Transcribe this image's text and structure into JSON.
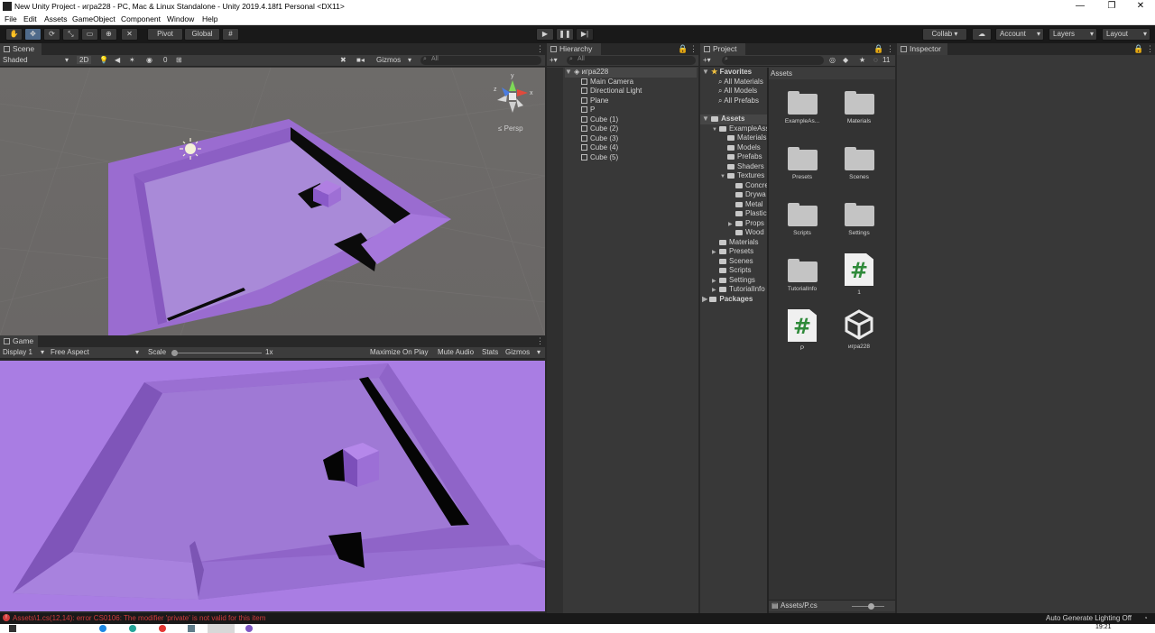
{
  "window": {
    "title": "New Unity Project - игра228 - PC, Mac & Linux Standalone - Unity 2019.4.18f1 Personal <DX11>",
    "minimize": "—",
    "restore": "❐",
    "close": "✕"
  },
  "menu": [
    "File",
    "Edit",
    "Assets",
    "GameObject",
    "Component",
    "Window",
    "Help"
  ],
  "toolbar": {
    "pivot": "Pivot",
    "global": "Global",
    "collab": "Collab ▾",
    "account": "Account",
    "layers": "Layers",
    "layout": "Layout"
  },
  "scene": {
    "tab": "Scene",
    "shading": "Shaded",
    "mode2d": "2D",
    "gizmos": "Gizmos",
    "search_placeholder": "All",
    "hidden_count": "0",
    "persp": "≤ Persp",
    "axis_y": "y",
    "axis_x": "x",
    "axis_z": "z"
  },
  "game": {
    "tab": "Game",
    "display": "Display 1",
    "aspect": "Free Aspect",
    "scale_label": "Scale",
    "scale_value": "1x",
    "maximize": "Maximize On Play",
    "mute": "Mute Audio",
    "stats": "Stats",
    "gizmos": "Gizmos"
  },
  "hierarchy": {
    "tab": "Hierarchy",
    "search_placeholder": "All",
    "scene_name": "игра228",
    "items": [
      "Main Camera",
      "Directional Light",
      "Plane",
      "P",
      "Cube (1)",
      "Cube (2)",
      "Cube (3)",
      "Cube (4)",
      "Cube (5)"
    ]
  },
  "project": {
    "tab": "Project",
    "hidden_count": "11",
    "favorites": {
      "label": "Favorites",
      "items": [
        "All Materials",
        "All Models",
        "All Prefabs"
      ]
    },
    "assets_label": "Assets",
    "tree": [
      {
        "label": "ExampleAss",
        "indent": 1,
        "arrow": "▼"
      },
      {
        "label": "Materials",
        "indent": 2,
        "arrow": ""
      },
      {
        "label": "Models",
        "indent": 2,
        "arrow": ""
      },
      {
        "label": "Prefabs",
        "indent": 2,
        "arrow": ""
      },
      {
        "label": "Shaders",
        "indent": 2,
        "arrow": ""
      },
      {
        "label": "Textures",
        "indent": 2,
        "arrow": "▼"
      },
      {
        "label": "Concre",
        "indent": 3,
        "arrow": ""
      },
      {
        "label": "Drywa",
        "indent": 3,
        "arrow": ""
      },
      {
        "label": "Metal",
        "indent": 3,
        "arrow": ""
      },
      {
        "label": "Plastic",
        "indent": 3,
        "arrow": ""
      },
      {
        "label": "Props",
        "indent": 3,
        "arrow": "▶"
      },
      {
        "label": "Wood",
        "indent": 3,
        "arrow": ""
      },
      {
        "label": "Materials",
        "indent": 1,
        "arrow": ""
      },
      {
        "label": "Presets",
        "indent": 1,
        "arrow": "▶"
      },
      {
        "label": "Scenes",
        "indent": 1,
        "arrow": ""
      },
      {
        "label": "Scripts",
        "indent": 1,
        "arrow": ""
      },
      {
        "label": "Settings",
        "indent": 1,
        "arrow": "▶"
      },
      {
        "label": "TutorialInfo",
        "indent": 1,
        "arrow": "▶"
      }
    ],
    "packages_label": "Packages",
    "grid_header": "Assets",
    "assets": [
      {
        "name": "ExampleAs...",
        "kind": "folder"
      },
      {
        "name": "Materials",
        "kind": "folder"
      },
      {
        "name": "Presets",
        "kind": "folder"
      },
      {
        "name": "Scenes",
        "kind": "folder"
      },
      {
        "name": "Scripts",
        "kind": "folder"
      },
      {
        "name": "Settings",
        "kind": "folder"
      },
      {
        "name": "TutorialInfo",
        "kind": "folder"
      },
      {
        "name": "1",
        "kind": "script"
      },
      {
        "name": "P",
        "kind": "script"
      },
      {
        "name": "игра228",
        "kind": "unity"
      }
    ],
    "selected_path": "Assets/P.cs"
  },
  "inspector": {
    "tab": "Inspector"
  },
  "status": {
    "error": "Assets\\1.cs(12,14): error CS0106: The modifier 'private' is not valid for this item",
    "lighting": "Auto Generate Lighting Off",
    "clock": "19:21"
  },
  "colors": {
    "error_red": "#d23c3c",
    "accent_blue": "#3e5f96",
    "purple": "#9a6cd0",
    "game_bg": "#a97de3"
  }
}
